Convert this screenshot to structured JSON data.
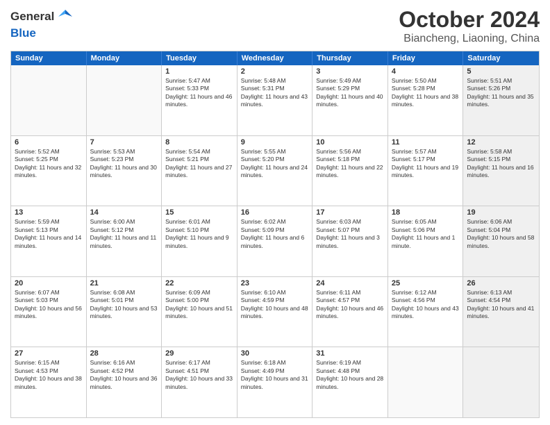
{
  "header": {
    "logo_line1": "General",
    "logo_line2": "Blue",
    "month": "October 2024",
    "location": "Biancheng, Liaoning, China"
  },
  "days_of_week": [
    "Sunday",
    "Monday",
    "Tuesday",
    "Wednesday",
    "Thursday",
    "Friday",
    "Saturday"
  ],
  "rows": [
    [
      {
        "day": "",
        "info": "",
        "shaded": false,
        "empty": true
      },
      {
        "day": "",
        "info": "",
        "shaded": false,
        "empty": true
      },
      {
        "day": "1",
        "info": "Sunrise: 5:47 AM\nSunset: 5:33 PM\nDaylight: 11 hours and 46 minutes.",
        "shaded": false,
        "empty": false
      },
      {
        "day": "2",
        "info": "Sunrise: 5:48 AM\nSunset: 5:31 PM\nDaylight: 11 hours and 43 minutes.",
        "shaded": false,
        "empty": false
      },
      {
        "day": "3",
        "info": "Sunrise: 5:49 AM\nSunset: 5:29 PM\nDaylight: 11 hours and 40 minutes.",
        "shaded": false,
        "empty": false
      },
      {
        "day": "4",
        "info": "Sunrise: 5:50 AM\nSunset: 5:28 PM\nDaylight: 11 hours and 38 minutes.",
        "shaded": false,
        "empty": false
      },
      {
        "day": "5",
        "info": "Sunrise: 5:51 AM\nSunset: 5:26 PM\nDaylight: 11 hours and 35 minutes.",
        "shaded": true,
        "empty": false
      }
    ],
    [
      {
        "day": "6",
        "info": "Sunrise: 5:52 AM\nSunset: 5:25 PM\nDaylight: 11 hours and 32 minutes.",
        "shaded": false,
        "empty": false
      },
      {
        "day": "7",
        "info": "Sunrise: 5:53 AM\nSunset: 5:23 PM\nDaylight: 11 hours and 30 minutes.",
        "shaded": false,
        "empty": false
      },
      {
        "day": "8",
        "info": "Sunrise: 5:54 AM\nSunset: 5:21 PM\nDaylight: 11 hours and 27 minutes.",
        "shaded": false,
        "empty": false
      },
      {
        "day": "9",
        "info": "Sunrise: 5:55 AM\nSunset: 5:20 PM\nDaylight: 11 hours and 24 minutes.",
        "shaded": false,
        "empty": false
      },
      {
        "day": "10",
        "info": "Sunrise: 5:56 AM\nSunset: 5:18 PM\nDaylight: 11 hours and 22 minutes.",
        "shaded": false,
        "empty": false
      },
      {
        "day": "11",
        "info": "Sunrise: 5:57 AM\nSunset: 5:17 PM\nDaylight: 11 hours and 19 minutes.",
        "shaded": false,
        "empty": false
      },
      {
        "day": "12",
        "info": "Sunrise: 5:58 AM\nSunset: 5:15 PM\nDaylight: 11 hours and 16 minutes.",
        "shaded": true,
        "empty": false
      }
    ],
    [
      {
        "day": "13",
        "info": "Sunrise: 5:59 AM\nSunset: 5:13 PM\nDaylight: 11 hours and 14 minutes.",
        "shaded": false,
        "empty": false
      },
      {
        "day": "14",
        "info": "Sunrise: 6:00 AM\nSunset: 5:12 PM\nDaylight: 11 hours and 11 minutes.",
        "shaded": false,
        "empty": false
      },
      {
        "day": "15",
        "info": "Sunrise: 6:01 AM\nSunset: 5:10 PM\nDaylight: 11 hours and 9 minutes.",
        "shaded": false,
        "empty": false
      },
      {
        "day": "16",
        "info": "Sunrise: 6:02 AM\nSunset: 5:09 PM\nDaylight: 11 hours and 6 minutes.",
        "shaded": false,
        "empty": false
      },
      {
        "day": "17",
        "info": "Sunrise: 6:03 AM\nSunset: 5:07 PM\nDaylight: 11 hours and 3 minutes.",
        "shaded": false,
        "empty": false
      },
      {
        "day": "18",
        "info": "Sunrise: 6:05 AM\nSunset: 5:06 PM\nDaylight: 11 hours and 1 minute.",
        "shaded": false,
        "empty": false
      },
      {
        "day": "19",
        "info": "Sunrise: 6:06 AM\nSunset: 5:04 PM\nDaylight: 10 hours and 58 minutes.",
        "shaded": true,
        "empty": false
      }
    ],
    [
      {
        "day": "20",
        "info": "Sunrise: 6:07 AM\nSunset: 5:03 PM\nDaylight: 10 hours and 56 minutes.",
        "shaded": false,
        "empty": false
      },
      {
        "day": "21",
        "info": "Sunrise: 6:08 AM\nSunset: 5:01 PM\nDaylight: 10 hours and 53 minutes.",
        "shaded": false,
        "empty": false
      },
      {
        "day": "22",
        "info": "Sunrise: 6:09 AM\nSunset: 5:00 PM\nDaylight: 10 hours and 51 minutes.",
        "shaded": false,
        "empty": false
      },
      {
        "day": "23",
        "info": "Sunrise: 6:10 AM\nSunset: 4:59 PM\nDaylight: 10 hours and 48 minutes.",
        "shaded": false,
        "empty": false
      },
      {
        "day": "24",
        "info": "Sunrise: 6:11 AM\nSunset: 4:57 PM\nDaylight: 10 hours and 46 minutes.",
        "shaded": false,
        "empty": false
      },
      {
        "day": "25",
        "info": "Sunrise: 6:12 AM\nSunset: 4:56 PM\nDaylight: 10 hours and 43 minutes.",
        "shaded": false,
        "empty": false
      },
      {
        "day": "26",
        "info": "Sunrise: 6:13 AM\nSunset: 4:54 PM\nDaylight: 10 hours and 41 minutes.",
        "shaded": true,
        "empty": false
      }
    ],
    [
      {
        "day": "27",
        "info": "Sunrise: 6:15 AM\nSunset: 4:53 PM\nDaylight: 10 hours and 38 minutes.",
        "shaded": false,
        "empty": false
      },
      {
        "day": "28",
        "info": "Sunrise: 6:16 AM\nSunset: 4:52 PM\nDaylight: 10 hours and 36 minutes.",
        "shaded": false,
        "empty": false
      },
      {
        "day": "29",
        "info": "Sunrise: 6:17 AM\nSunset: 4:51 PM\nDaylight: 10 hours and 33 minutes.",
        "shaded": false,
        "empty": false
      },
      {
        "day": "30",
        "info": "Sunrise: 6:18 AM\nSunset: 4:49 PM\nDaylight: 10 hours and 31 minutes.",
        "shaded": false,
        "empty": false
      },
      {
        "day": "31",
        "info": "Sunrise: 6:19 AM\nSunset: 4:48 PM\nDaylight: 10 hours and 28 minutes.",
        "shaded": false,
        "empty": false
      },
      {
        "day": "",
        "info": "",
        "shaded": false,
        "empty": true
      },
      {
        "day": "",
        "info": "",
        "shaded": true,
        "empty": true
      }
    ]
  ]
}
